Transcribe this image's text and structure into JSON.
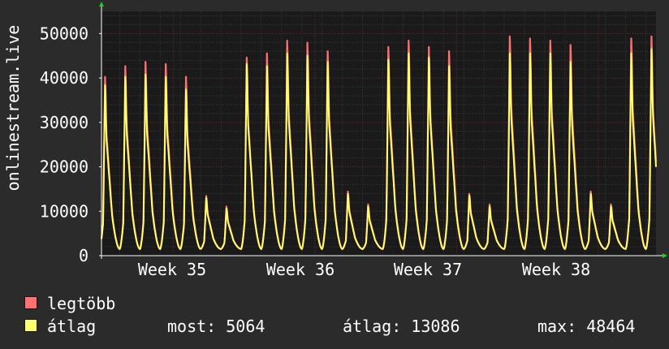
{
  "chart_data": {
    "type": "line",
    "title": "",
    "ylabel": "onlinestream.live",
    "xlabel": "",
    "ylim": [
      0,
      55000
    ],
    "yticks": [
      0,
      10000,
      20000,
      30000,
      40000,
      50000
    ],
    "ytick_labels": [
      "0",
      "10000",
      "20000",
      "30000",
      "40000",
      "50000"
    ],
    "xtick_labels": [
      "Week 35",
      "Week 36",
      "Week 37",
      "Week 38"
    ],
    "grid": true,
    "background": "#1a1a1a",
    "days_shown": 26,
    "daily_peaks": [
      {
        "max": 42000,
        "avg": 40000
      },
      {
        "max": 44500,
        "avg": 42000
      },
      {
        "max": 45500,
        "avg": 42500
      },
      {
        "max": 45000,
        "avg": 42000
      },
      {
        "max": 42000,
        "avg": 39000
      },
      {
        "max": 14000,
        "avg": 13500
      },
      {
        "max": 11500,
        "avg": 11000
      },
      {
        "max": 46500,
        "avg": 45000
      },
      {
        "max": 47500,
        "avg": 44500
      },
      {
        "max": 50500,
        "avg": 47500
      },
      {
        "max": 50000,
        "avg": 47000
      },
      {
        "max": 48000,
        "avg": 45500
      },
      {
        "max": 15000,
        "avg": 14500
      },
      {
        "max": 12000,
        "avg": 11500
      },
      {
        "max": 49000,
        "avg": 46000
      },
      {
        "max": 50500,
        "avg": 47500
      },
      {
        "max": 49000,
        "avg": 46500
      },
      {
        "max": 48000,
        "avg": 44500
      },
      {
        "max": 14500,
        "avg": 14000
      },
      {
        "max": 12000,
        "avg": 11500
      },
      {
        "max": 51500,
        "avg": 47500
      },
      {
        "max": 51000,
        "avg": 47500
      },
      {
        "max": 50500,
        "avg": 47500
      },
      {
        "max": 49500,
        "avg": 45500
      },
      {
        "max": 15000,
        "avg": 14500
      },
      {
        "max": 12000,
        "avg": 11500
      },
      {
        "max": 51000,
        "avg": 47500
      },
      {
        "max": 51500,
        "avg": 48500
      }
    ],
    "daily_min": 1500,
    "gap_days": [
      5
    ],
    "series": [
      {
        "name": "legtöbb",
        "color": "#ff7070"
      },
      {
        "name": "átlag",
        "color": "#ffff70"
      }
    ]
  },
  "legend": {
    "max_label": "legtöbb",
    "avg_label": "átlag",
    "max_color": "#ff7070",
    "avg_color": "#ffff70",
    "stats": {
      "current": "most: 5064",
      "average": "átlag: 13086",
      "maximum": "max: 48464"
    }
  }
}
